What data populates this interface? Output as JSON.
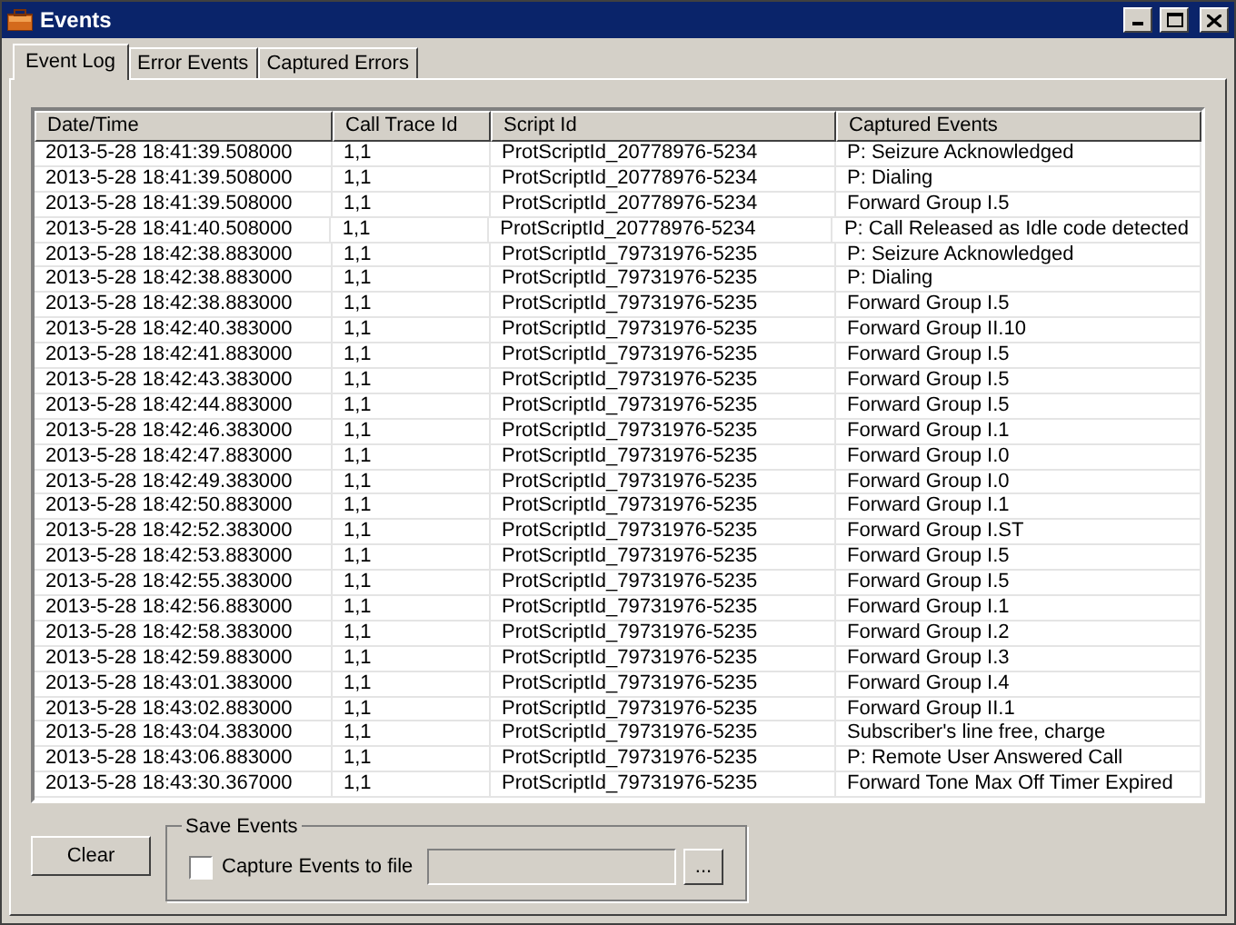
{
  "window": {
    "title": "Events"
  },
  "tabs": [
    {
      "label": "Event Log",
      "selected": true
    },
    {
      "label": "Error Events",
      "selected": false
    },
    {
      "label": "Captured Errors",
      "selected": false
    }
  ],
  "table": {
    "columns": [
      "Date/Time",
      "Call Trace Id",
      "Script Id",
      "Captured Events"
    ],
    "rows": [
      [
        "2013-5-28 18:41:39.508000",
        "1,1",
        "ProtScriptId_20778976-5234",
        "P: Seizure Acknowledged"
      ],
      [
        "2013-5-28 18:41:39.508000",
        "1,1",
        "ProtScriptId_20778976-5234",
        "P: Dialing"
      ],
      [
        "2013-5-28 18:41:39.508000",
        "1,1",
        "ProtScriptId_20778976-5234",
        "Forward Group I.5"
      ],
      [
        "2013-5-28 18:41:40.508000",
        "1,1",
        "ProtScriptId_20778976-5234",
        "P: Call Released as Idle code detected"
      ],
      [
        "2013-5-28 18:42:38.883000",
        "1,1",
        "ProtScriptId_79731976-5235",
        "P: Seizure Acknowledged"
      ],
      [
        "2013-5-28 18:42:38.883000",
        "1,1",
        "ProtScriptId_79731976-5235",
        "P: Dialing"
      ],
      [
        "2013-5-28 18:42:38.883000",
        "1,1",
        "ProtScriptId_79731976-5235",
        "Forward Group I.5"
      ],
      [
        "2013-5-28 18:42:40.383000",
        "1,1",
        "ProtScriptId_79731976-5235",
        "Forward Group II.10"
      ],
      [
        "2013-5-28 18:42:41.883000",
        "1,1",
        "ProtScriptId_79731976-5235",
        "Forward Group I.5"
      ],
      [
        "2013-5-28 18:42:43.383000",
        "1,1",
        "ProtScriptId_79731976-5235",
        "Forward Group I.5"
      ],
      [
        "2013-5-28 18:42:44.883000",
        "1,1",
        "ProtScriptId_79731976-5235",
        "Forward Group I.5"
      ],
      [
        "2013-5-28 18:42:46.383000",
        "1,1",
        "ProtScriptId_79731976-5235",
        "Forward Group I.1"
      ],
      [
        "2013-5-28 18:42:47.883000",
        "1,1",
        "ProtScriptId_79731976-5235",
        "Forward Group I.0"
      ],
      [
        "2013-5-28 18:42:49.383000",
        "1,1",
        "ProtScriptId_79731976-5235",
        "Forward Group I.0"
      ],
      [
        "2013-5-28 18:42:50.883000",
        "1,1",
        "ProtScriptId_79731976-5235",
        "Forward Group I.1"
      ],
      [
        "2013-5-28 18:42:52.383000",
        "1,1",
        "ProtScriptId_79731976-5235",
        "Forward Group I.ST"
      ],
      [
        "2013-5-28 18:42:53.883000",
        "1,1",
        "ProtScriptId_79731976-5235",
        "Forward Group I.5"
      ],
      [
        "2013-5-28 18:42:55.383000",
        "1,1",
        "ProtScriptId_79731976-5235",
        "Forward Group I.5"
      ],
      [
        "2013-5-28 18:42:56.883000",
        "1,1",
        "ProtScriptId_79731976-5235",
        "Forward Group I.1"
      ],
      [
        "2013-5-28 18:42:58.383000",
        "1,1",
        "ProtScriptId_79731976-5235",
        "Forward Group I.2"
      ],
      [
        "2013-5-28 18:42:59.883000",
        "1,1",
        "ProtScriptId_79731976-5235",
        "Forward Group I.3"
      ],
      [
        "2013-5-28 18:43:01.383000",
        "1,1",
        "ProtScriptId_79731976-5235",
        "Forward Group I.4"
      ],
      [
        "2013-5-28 18:43:02.883000",
        "1,1",
        "ProtScriptId_79731976-5235",
        "Forward Group II.1"
      ],
      [
        "2013-5-28 18:43:04.383000",
        "1,1",
        "ProtScriptId_79731976-5235",
        "Subscriber's line free, charge"
      ],
      [
        "2013-5-28 18:43:06.883000",
        "1,1",
        "ProtScriptId_79731976-5235",
        "P: Remote User Answered Call"
      ],
      [
        "2013-5-28 18:43:30.367000",
        "1,1",
        "ProtScriptId_79731976-5235",
        "Forward Tone Max Off Timer Expired"
      ]
    ]
  },
  "clear_button": "Clear",
  "save_events": {
    "title": "Save Events",
    "checkbox": {
      "label": "Capture Events to file",
      "checked": false
    },
    "file_field": {
      "disabled": true
    },
    "browse_button": "..."
  }
}
